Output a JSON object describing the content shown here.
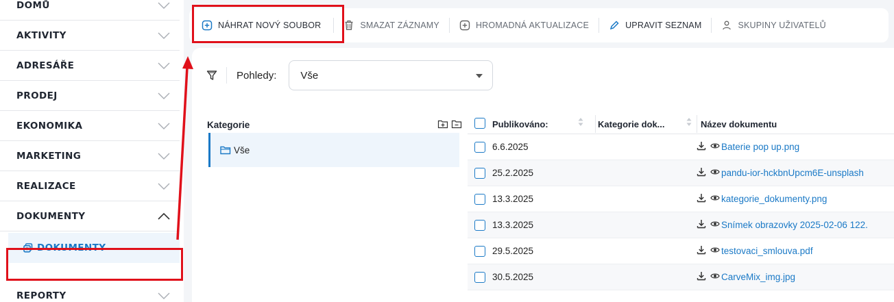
{
  "colors": {
    "accent": "#1a79c6",
    "annotation": "#e0101a",
    "sidebar_active_bg": "#eef5fc"
  },
  "sidebar": {
    "items": [
      {
        "label": "DOMŮ",
        "chevron": "chevron-down-icon"
      },
      {
        "label": "AKTIVITY",
        "chevron": "chevron-down-icon"
      },
      {
        "label": "ADRESÁŘE",
        "chevron": "chevron-down-icon"
      },
      {
        "label": "PRODEJ",
        "chevron": "chevron-down-icon"
      },
      {
        "label": "EKONOMIKA",
        "chevron": "chevron-down-icon"
      },
      {
        "label": "MARKETING",
        "chevron": "chevron-down-icon"
      },
      {
        "label": "REALIZACE",
        "chevron": "chevron-down-icon"
      },
      {
        "label": "DOKUMENTY",
        "chevron": "chevron-up-icon"
      },
      {
        "label": "REPORTY",
        "chevron": "chevron-down-icon"
      }
    ],
    "subitem": {
      "label": "DOKUMENTY",
      "icon": "documents-icon"
    }
  },
  "toolbar": {
    "upload_label": "NÁHRAT NOVÝ SOUBOR",
    "delete_label": "SMAZAT ZÁZNAMY",
    "bulk_update_label": "HROMADNÁ AKTUALIZACE",
    "edit_list_label": "UPRAVIT SEZNAM",
    "user_groups_label": "SKUPINY UŽIVATELŮ"
  },
  "filter": {
    "views_label": "Pohledy:",
    "views_value": "Vše"
  },
  "categories": {
    "title": "Kategorie",
    "items": [
      {
        "label": "Vše"
      }
    ]
  },
  "table": {
    "columns": [
      "Publikováno:",
      "Kategorie dok...",
      "Název dokumentu"
    ],
    "rows": [
      {
        "published": "6.6.2025",
        "name": "Baterie pop up.png"
      },
      {
        "published": "25.2.2025",
        "name": "pandu-ior-hckbnUpcm6E-unsplash"
      },
      {
        "published": "13.3.2025",
        "name": "kategorie_dokumenty.png"
      },
      {
        "published": "13.3.2025",
        "name": "Snímek obrazovky 2025-02-06 122."
      },
      {
        "published": "29.5.2025",
        "name": "testovaci_smlouva.pdf"
      },
      {
        "published": "30.5.2025",
        "name": "CarveMix_img.jpg"
      }
    ]
  }
}
